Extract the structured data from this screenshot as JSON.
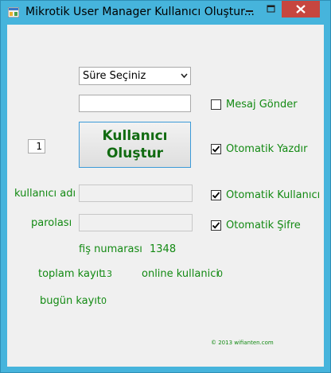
{
  "window": {
    "title": "Mikrotik User Manager Kullanıcı Oluştur..."
  },
  "form": {
    "duration_select": {
      "value": "Süre Seçiniz"
    },
    "message_input": {
      "value": ""
    },
    "create_button": {
      "line1": "Kullanıcı",
      "line2": "Oluştur"
    },
    "count_input": {
      "value": "1"
    },
    "username_label": "kullanıcı adı",
    "username_input": {
      "value": ""
    },
    "password_label": "parolası",
    "password_input": {
      "value": ""
    },
    "checkboxes": [
      {
        "label": "Mesaj Gönder",
        "checked": false
      },
      {
        "label": "Otomatik Yazdır",
        "checked": true
      },
      {
        "label": "Otomatik Kullanıcı",
        "checked": true
      },
      {
        "label": "Otomatik Şifre",
        "checked": true
      }
    ],
    "receipt_label": "fiş numarası",
    "receipt_value": "1348",
    "total_label": "toplam kayıt",
    "total_value": "13",
    "online_label": "online kullanici",
    "online_value": "0",
    "today_label": "bugün kayıt",
    "today_value": "0",
    "copyright": "© 2013 wifianten.com"
  },
  "colors": {
    "label_green": "#138a13",
    "frame_blue": "#46b4dc",
    "close_red": "#c7463f"
  }
}
